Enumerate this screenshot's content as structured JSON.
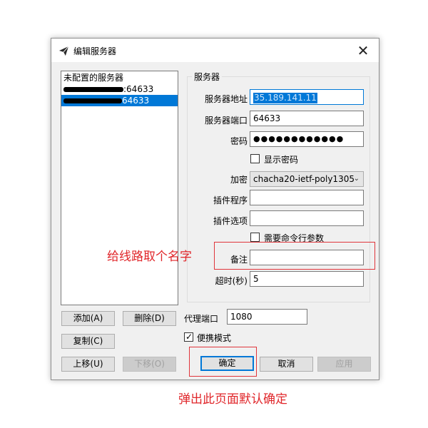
{
  "dialog": {
    "title": "编辑服务器",
    "close_glyph": "✕"
  },
  "server_list": {
    "items": [
      {
        "label": "未配置的服务器",
        "redacted_prefix": false,
        "suffix": ""
      },
      {
        "label": "",
        "redacted_prefix": true,
        "suffix": ":64633"
      },
      {
        "label": "",
        "redacted_prefix": true,
        "suffix": "64633",
        "selected": true
      }
    ]
  },
  "server_group": {
    "title": "服务器",
    "address_label": "服务器地址",
    "address_value": "35.189.141.11",
    "port_label": "服务器端口",
    "port_value": "64633",
    "password_label": "密码",
    "password_value": "●●●●●●●●●●●●",
    "show_password_label": "显示密码",
    "show_password_checked": false,
    "encryption_label": "加密",
    "encryption_value": "chacha20-ietf-poly1305",
    "plugin_label": "插件程序",
    "plugin_value": "",
    "plugin_options_label": "插件选项",
    "plugin_options_value": "",
    "need_cmd_args_label": "需要命令行参数",
    "need_cmd_args_checked": false,
    "remark_label": "备注",
    "remark_value": "",
    "timeout_label": "超时(秒)",
    "timeout_value": "5"
  },
  "list_buttons": {
    "add": "添加(A)",
    "delete": "删除(D)",
    "copy": "复制(C)",
    "move_up": "上移(U)",
    "move_down": "下移(O)"
  },
  "proxy": {
    "port_label": "代理端口",
    "port_value": "1080",
    "portable_label": "便携模式",
    "portable_checked": true
  },
  "action_buttons": {
    "ok": "确定",
    "cancel": "取消",
    "apply": "应用"
  },
  "annotations": {
    "remark_note": "给线路取个名字",
    "ok_note": "弹出此页面默认确定",
    "color": "#e0262a"
  },
  "colors": {
    "selection": "#0078d7",
    "dialog_bg": "#f0f0f0"
  }
}
